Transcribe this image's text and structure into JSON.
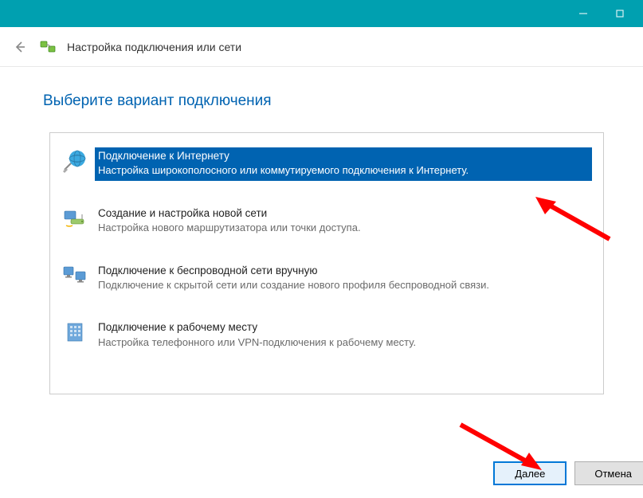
{
  "header": {
    "title": "Настройка подключения или сети"
  },
  "heading": "Выберите вариант подключения",
  "options": [
    {
      "title": "Подключение к Интернету",
      "desc": "Настройка широкополосного или коммутируемого подключения к Интернету."
    },
    {
      "title": "Создание и настройка новой сети",
      "desc": "Настройка нового маршрутизатора или точки доступа."
    },
    {
      "title": "Подключение к беспроводной сети вручную",
      "desc": "Подключение к скрытой сети или создание нового профиля беспроводной связи."
    },
    {
      "title": "Подключение к рабочему месту",
      "desc": "Настройка телефонного или VPN-подключения к рабочему месту."
    }
  ],
  "buttons": {
    "next": "Далее",
    "cancel": "Отмена"
  }
}
